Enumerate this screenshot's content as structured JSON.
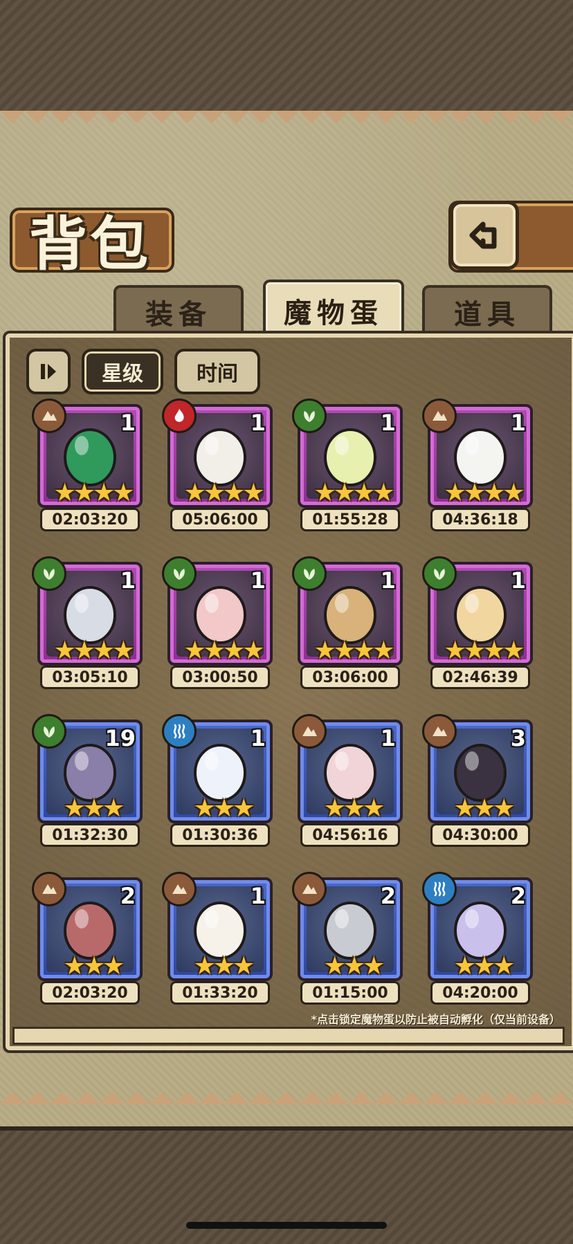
{
  "title": "背包",
  "tabs": [
    {
      "label": "装备",
      "active": false
    },
    {
      "label": "魔物蛋",
      "active": true
    },
    {
      "label": "道具",
      "active": false
    }
  ],
  "filters": {
    "star_label": "星级",
    "time_label": "时间"
  },
  "eggs": [
    {
      "element": "earth",
      "count": "1",
      "stars": "★★★★",
      "time": "02:03:20",
      "rarity": "purple",
      "color": "#2f9a5c"
    },
    {
      "element": "fire",
      "count": "1",
      "stars": "★★★★",
      "time": "05:06:00",
      "rarity": "purple",
      "color": "#f2efe8"
    },
    {
      "element": "grass",
      "count": "1",
      "stars": "★★★★",
      "time": "01:55:28",
      "rarity": "purple",
      "color": "#e8f0b0"
    },
    {
      "element": "earth",
      "count": "1",
      "stars": "★★★★",
      "time": "04:36:18",
      "rarity": "purple",
      "color": "#f4f4f0"
    },
    {
      "element": "grass",
      "count": "1",
      "stars": "★★★★",
      "time": "03:05:10",
      "rarity": "purple",
      "color": "#d8dce4"
    },
    {
      "element": "grass",
      "count": "1",
      "stars": "★★★★",
      "time": "03:00:50",
      "rarity": "purple",
      "color": "#f3c8c8"
    },
    {
      "element": "grass",
      "count": "1",
      "stars": "★★★★",
      "time": "03:06:00",
      "rarity": "purple",
      "color": "#d8b27a"
    },
    {
      "element": "grass",
      "count": "1",
      "stars": "★★★★",
      "time": "02:46:39",
      "rarity": "purple",
      "color": "#f2d6a0"
    },
    {
      "element": "grass",
      "count": "19",
      "stars": "★★★",
      "time": "01:32:30",
      "rarity": "blue",
      "color": "#8a7fa8"
    },
    {
      "element": "water",
      "count": "1",
      "stars": "★★★",
      "time": "01:30:36",
      "rarity": "blue",
      "color": "#eef2fa"
    },
    {
      "element": "earth",
      "count": "1",
      "stars": "★★★",
      "time": "04:56:16",
      "rarity": "blue",
      "color": "#f0d4d8"
    },
    {
      "element": "earth",
      "count": "3",
      "stars": "★★★",
      "time": "04:30:00",
      "rarity": "blue",
      "color": "#3a3240"
    },
    {
      "element": "earth",
      "count": "2",
      "stars": "★★★",
      "time": "02:03:20",
      "rarity": "blue",
      "color": "#b86a6a"
    },
    {
      "element": "earth",
      "count": "1",
      "stars": "★★★",
      "time": "01:33:20",
      "rarity": "blue",
      "color": "#f6f2ea"
    },
    {
      "element": "earth",
      "count": "2",
      "stars": "★★★",
      "time": "01:15:00",
      "rarity": "blue",
      "color": "#c8ccd2"
    },
    {
      "element": "water",
      "count": "2",
      "stars": "★★★",
      "time": "04:20:00",
      "rarity": "blue",
      "color": "#c9c0ec"
    }
  ],
  "hint": "*点击锁定魔物蛋以防止被自动孵化（仅当前设备）"
}
